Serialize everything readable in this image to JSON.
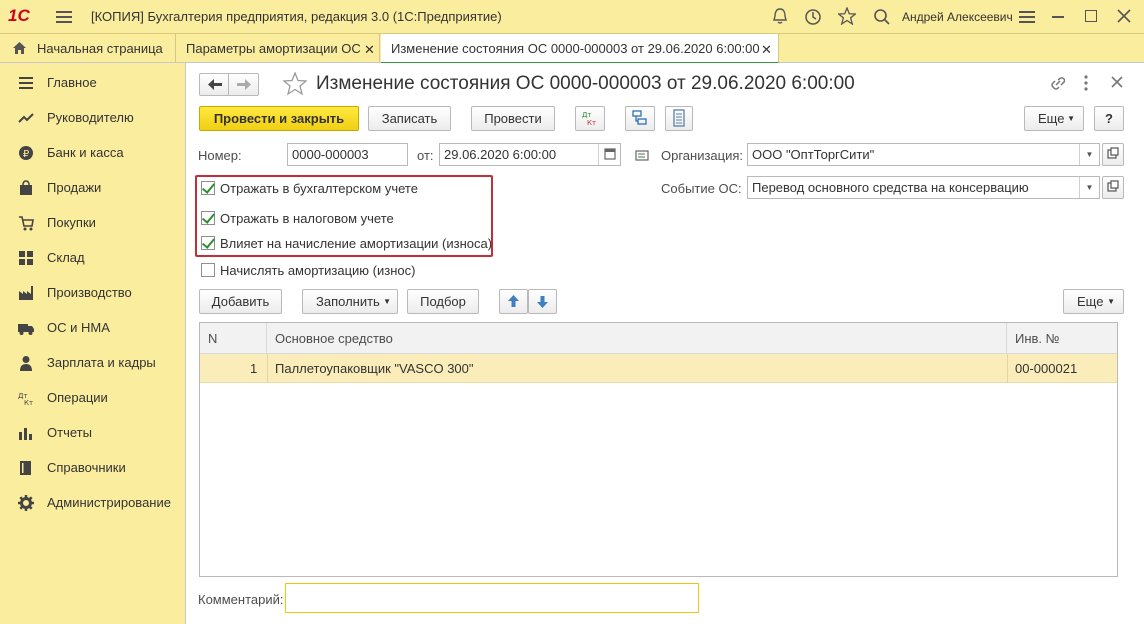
{
  "window": {
    "title": "[КОПИЯ] Бухгалтерия предприятия, редакция 3.0  (1С:Предприятие)",
    "user": "Андрей Алексеевич",
    "logo_text": "1С"
  },
  "tabs": [
    {
      "label": "Начальная страница",
      "active": false
    },
    {
      "label": "Параметры амортизации ОС",
      "active": false
    },
    {
      "label": "Изменение состояния ОС 0000-000003 от 29.06.2020 6:00:00",
      "active": true
    }
  ],
  "sidebar": {
    "items": [
      {
        "label": "Главное",
        "icon": "menu-icon"
      },
      {
        "label": "Руководителю",
        "icon": "trend-icon"
      },
      {
        "label": "Банк и касса",
        "icon": "ruble-icon"
      },
      {
        "label": "Продажи",
        "icon": "cart-icon"
      },
      {
        "label": "Покупки",
        "icon": "shop-icon"
      },
      {
        "label": "Склад",
        "icon": "warehouse-icon"
      },
      {
        "label": "Производство",
        "icon": "factory-icon"
      },
      {
        "label": "ОС и НМА",
        "icon": "truck-icon"
      },
      {
        "label": "Зарплата и кадры",
        "icon": "person-icon"
      },
      {
        "label": "Операции",
        "icon": "dtkt-icon"
      },
      {
        "label": "Отчеты",
        "icon": "bar-chart-icon"
      },
      {
        "label": "Справочники",
        "icon": "book-icon"
      },
      {
        "label": "Администрирование",
        "icon": "gear-icon"
      }
    ]
  },
  "document": {
    "title": "Изменение состояния ОС 0000-000003 от 29.06.2020 6:00:00",
    "toolbar": {
      "post_close": "Провести и закрыть",
      "save": "Записать",
      "post": "Провести",
      "dtkt": "Дт Кт",
      "more": "Еще",
      "help": "?"
    },
    "number_label": "Номер:",
    "number_value": "0000-000003",
    "date_label": "от:",
    "date_value": "29.06.2020  6:00:00",
    "org_label": "Организация:",
    "org_value": "ООО \"ОптТоргСити\"",
    "event_label": "Событие ОС:",
    "event_value": "Перевод основного средства на консервацию",
    "checkboxes": [
      {
        "label": "Отражать в бухгалтерском учете",
        "checked": true
      },
      {
        "label": "Отражать в налоговом учете",
        "checked": true
      },
      {
        "label": "Влияет на начисление амортизации (износа)",
        "checked": true
      },
      {
        "label": "Начислять амортизацию (износ)",
        "checked": false
      }
    ],
    "table_toolbar": {
      "add": "Добавить",
      "fill": "Заполнить",
      "select": "Подбор",
      "more": "Еще"
    },
    "table": {
      "columns": [
        "N",
        "Основное средство",
        "Инв. №"
      ],
      "rows": [
        {
          "n": "1",
          "asset": "Паллетоупаковщик  \"VASCO 300\"",
          "inv": "00-000021"
        }
      ]
    },
    "comment_label": "Комментарий:",
    "comment_value": ""
  },
  "colors": {
    "accent_yellow": "#fbed9e",
    "primary_button": "#f5d81f",
    "active_tab_underline": "#3c9a3c",
    "highlight_box": "#c0303a",
    "selected_row": "#fbedb9"
  }
}
